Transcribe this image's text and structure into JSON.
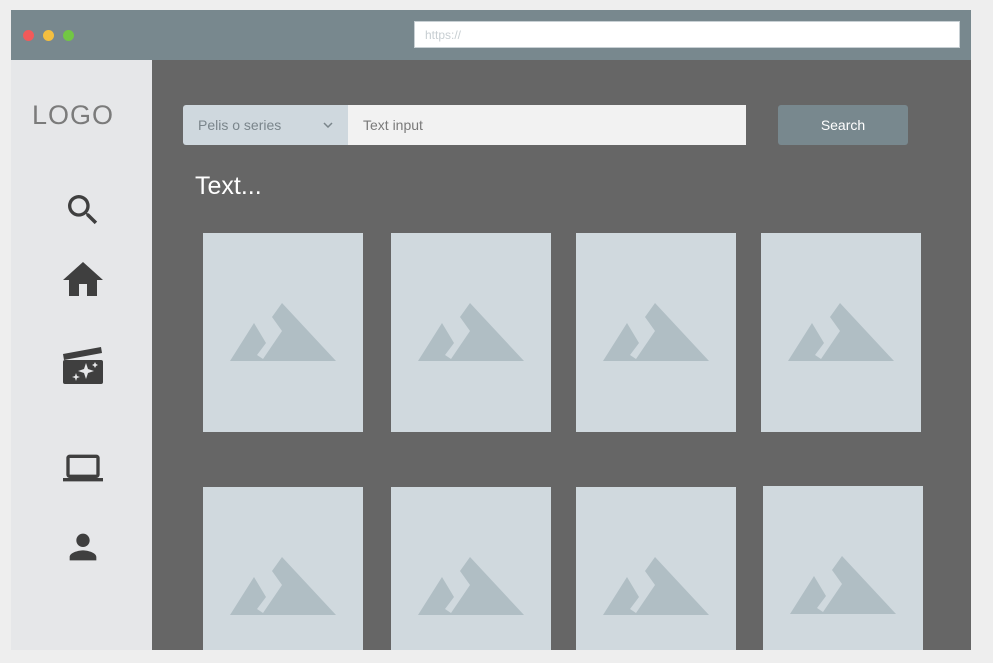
{
  "browser": {
    "url_placeholder": "https://",
    "controls": [
      "close",
      "minimize",
      "maximize"
    ]
  },
  "sidebar": {
    "logo": "LOGO",
    "items": [
      {
        "icon": "search-icon"
      },
      {
        "icon": "home-icon"
      },
      {
        "icon": "movie-clapper-icon"
      },
      {
        "icon": "laptop-icon"
      },
      {
        "icon": "user-icon"
      }
    ]
  },
  "search": {
    "select_value": "Pelis o series",
    "input_placeholder": "Text input",
    "button_label": "Search"
  },
  "main": {
    "section_text": "Text..."
  },
  "cards": [
    {
      "icon": "image-placeholder-icon"
    },
    {
      "icon": "image-placeholder-icon"
    },
    {
      "icon": "image-placeholder-icon"
    },
    {
      "icon": "image-placeholder-icon"
    },
    {
      "icon": "image-placeholder-icon"
    },
    {
      "icon": "image-placeholder-icon"
    },
    {
      "icon": "image-placeholder-icon"
    },
    {
      "icon": "image-placeholder-icon"
    }
  ],
  "colors": {
    "titlebar": "#78888e",
    "sidebar": "#e6e7e9",
    "content": "#666666",
    "card": "#d0d9de",
    "placeholder_icon": "#b0bec4",
    "button": "#78888e"
  }
}
